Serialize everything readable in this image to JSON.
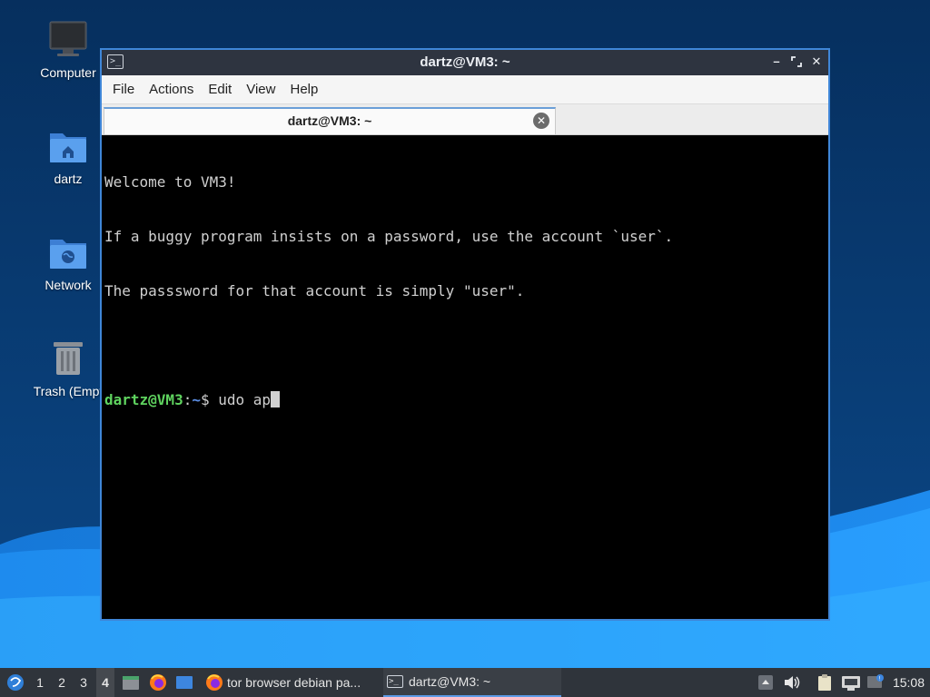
{
  "desktop": {
    "icons": [
      {
        "label": "Computer",
        "icon": "computer-icon"
      },
      {
        "label": "dartz",
        "icon": "home-folder-icon"
      },
      {
        "label": "Network",
        "icon": "network-folder-icon"
      },
      {
        "label": "Trash (Empt",
        "icon": "trash-icon"
      }
    ]
  },
  "window": {
    "title": "dartz@VM3: ~",
    "menu": [
      "File",
      "Actions",
      "Edit",
      "View",
      "Help"
    ],
    "tab_label": "dartz@VM3: ~",
    "terminal": {
      "lines": [
        "Welcome to VM3!",
        "If a buggy program insists on a password, use the account `user`.",
        "The passsword for that account is simply \"user\"."
      ],
      "prompt_user": "dartz@VM3",
      "prompt_colon": ":",
      "prompt_path": "~",
      "prompt_symbol": "$ ",
      "command": "udo ap"
    }
  },
  "taskbar": {
    "workspaces": [
      "1",
      "2",
      "3",
      "4"
    ],
    "active_workspace": "4",
    "tasks": [
      {
        "label": "tor browser debian pa...",
        "icon": "firefox-icon"
      },
      {
        "label": "dartz@VM3: ~",
        "icon": "terminal-icon"
      }
    ],
    "clock": "15:08"
  },
  "colors": {
    "accent": "#3f86d8",
    "prompt_user": "#5fd35f",
    "prompt_path": "#5c8fe6",
    "taskbar_bg": "#2f343b"
  }
}
